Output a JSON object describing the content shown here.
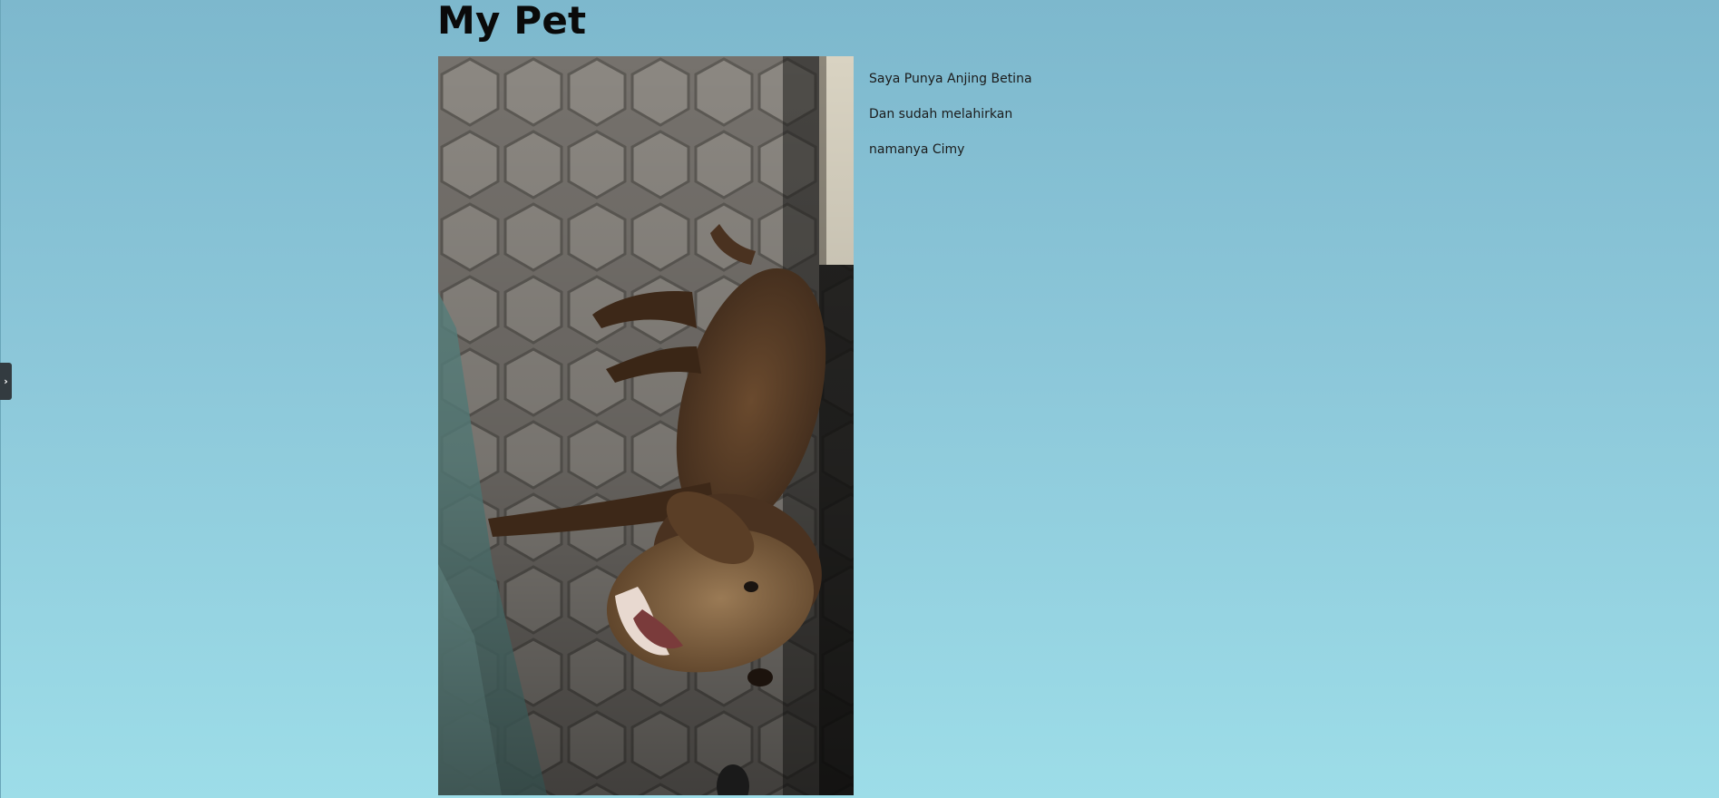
{
  "page": {
    "title": "My Pet"
  },
  "photo": {
    "alt": "Anjing Cimy",
    "subject": "brown dog on hexagonal paving stones"
  },
  "description": {
    "lines": [
      "Saya Punya Anjing Betina",
      "Dan sudah melahirkan",
      "namanya Cimy"
    ]
  },
  "sidebar_toggle": {
    "icon": "chevron-right-icon",
    "glyph": "›"
  },
  "colors": {
    "background_top": "#7db8cd",
    "background_bottom": "#9ddde8",
    "title": "#0a0a0a",
    "toggle_bg": "#333b40"
  }
}
